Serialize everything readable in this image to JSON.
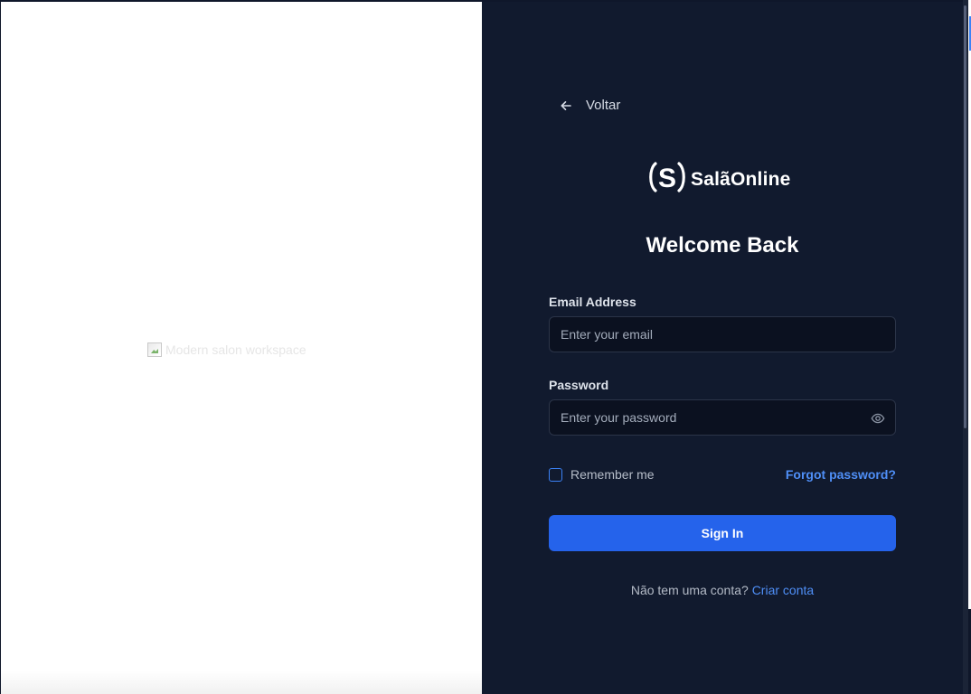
{
  "left": {
    "image_alt": "Modern salon workspace"
  },
  "nav": {
    "back_label": "Voltar"
  },
  "brand": {
    "name": "SalãOnline",
    "mark_letter": "S"
  },
  "form": {
    "title": "Welcome Back",
    "email_label": "Email Address",
    "email_placeholder": "Enter your email",
    "email_value": "",
    "password_label": "Password",
    "password_placeholder": "Enter your password",
    "password_value": "",
    "remember_label": "Remember me",
    "remember_checked": false,
    "forgot_label": "Forgot password?",
    "submit_label": "Sign In",
    "signup_prompt": "Não tem uma conta?",
    "signup_link": "Criar conta"
  },
  "icons": {
    "back": "arrow-left-icon",
    "toggle_password": "eye-icon",
    "broken_image": "broken-image-icon",
    "logo": "logo-s-icon"
  },
  "colors": {
    "panel_background": "#111a2e",
    "input_background": "#0b1120",
    "primary_button": "#2563eb",
    "link": "#4f8ff7",
    "checkbox_border": "#3b82f6"
  }
}
